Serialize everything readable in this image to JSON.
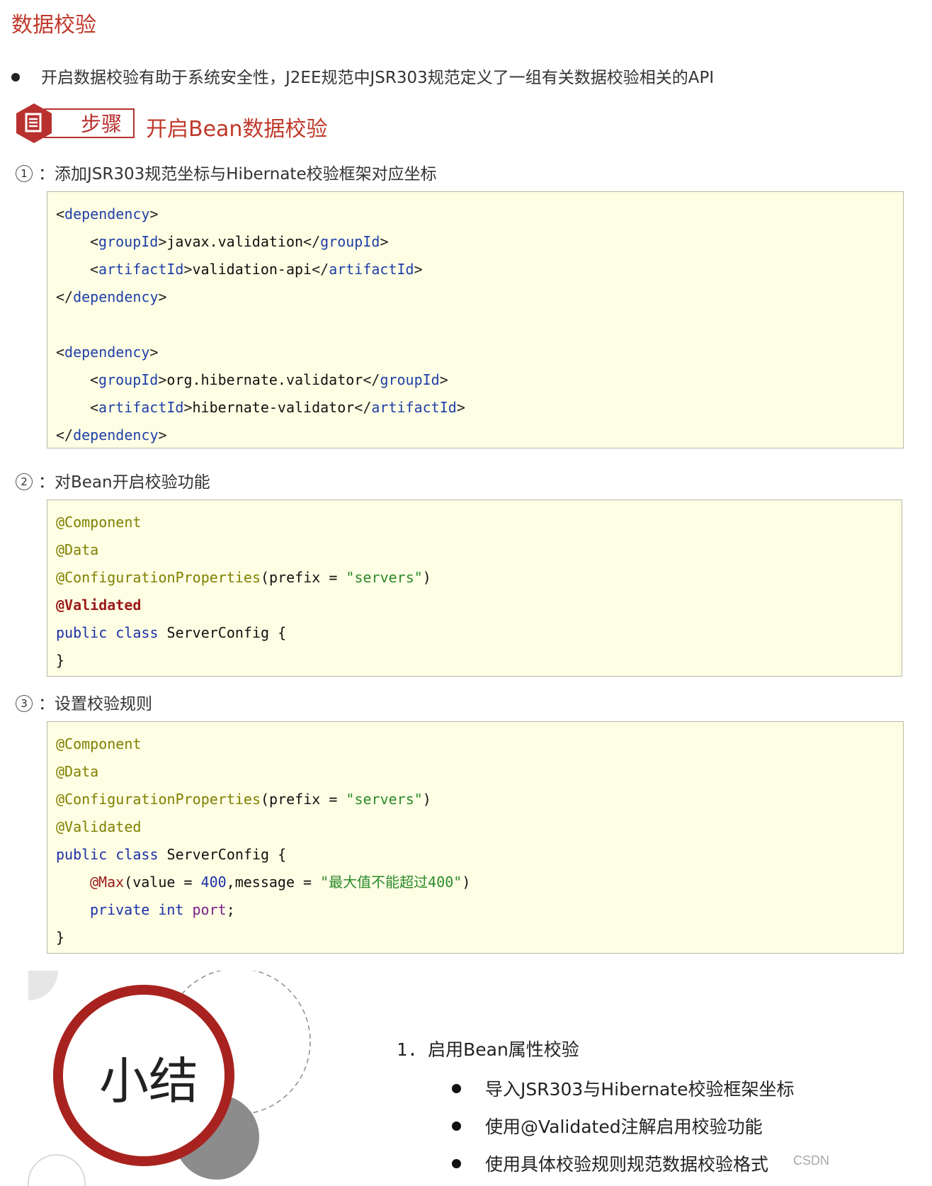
{
  "page": {
    "title": "数据校验",
    "intro": "开启数据校验有助于系统安全性，J2EE规范中JSR303规范定义了一组有关数据校验相关的API"
  },
  "steps": {
    "badge_label": "步骤",
    "heading": "开启Bean数据校验",
    "items": [
      {
        "num": "1",
        "text": "：添加JSR303规范坐标与Hibernate校验框架对应坐标"
      },
      {
        "num": "2",
        "text": "：对Bean开启校验功能"
      },
      {
        "num": "3",
        "text": "：设置校验规则"
      }
    ]
  },
  "code1": {
    "dep_tag": "dependency",
    "group_tag": "groupId",
    "artifact_tag": "artifactId",
    "group1": "javax.validation",
    "artifact1": "validation-api",
    "group2": "org.hibernate.validator",
    "artifact2": "hibernate-validator"
  },
  "code2": {
    "component": "@Component",
    "data": "@Data",
    "config_props": "@ConfigurationProperties",
    "prefix_open": "(prefix = ",
    "prefix_value": "\"servers\"",
    "prefix_close": ")",
    "validated": "@Validated",
    "kw_public": "public",
    "kw_class": "class",
    "class_decl": " ServerConfig {",
    "close_brace": "}"
  },
  "code3": {
    "component": "@Component",
    "data": "@Data",
    "config_props": "@ConfigurationProperties",
    "prefix_open": "(prefix = ",
    "prefix_value": "\"servers\"",
    "prefix_close": ")",
    "validated": "@Validated",
    "kw_public": "public",
    "kw_class": "class",
    "class_decl": " ServerConfig {",
    "max_ann": "@Max",
    "max_open": "(value = ",
    "max_value": "400",
    "max_mid": ",message = ",
    "max_msg": "\"最大值不能超过400\"",
    "max_close": ")",
    "kw_private": "private",
    "kw_int": "int",
    "field": "port",
    "semicolon": ";",
    "close_brace": "}"
  },
  "summary": {
    "title": "小结",
    "item1_num": "1.",
    "item1_text": "启用Bean属性校验",
    "subs": [
      "导入JSR303与Hibernate校验框架坐标",
      "使用@Validated注解启用校验功能",
      "使用具体校验规则规范数据校验格式"
    ]
  },
  "watermark": "CSDN",
  "colors": {
    "accent_red": "#b8312f",
    "code_bg": "#fefee4",
    "tag_blue": "#1f3fa8",
    "annotation_olive": "#808000",
    "string_green": "#2a8a2a"
  }
}
